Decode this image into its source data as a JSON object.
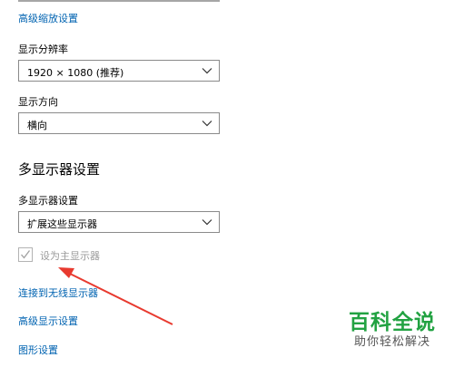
{
  "links": {
    "advanced_scaling": "高级缩放设置",
    "connect_wireless": "连接到无线显示器",
    "advanced_display": "高级显示设置",
    "graphics": "图形设置"
  },
  "resolution": {
    "label": "显示分辨率",
    "value": "1920 × 1080 (推荐)"
  },
  "orientation": {
    "label": "显示方向",
    "value": "横向"
  },
  "multi_display": {
    "section_title": "多显示器设置",
    "label": "多显示器设置",
    "value": "扩展这些显示器",
    "make_main_label": "设为主显示器",
    "make_main_checked": true,
    "make_main_disabled": true
  },
  "annotation": {
    "arrow_color": "#e83a2f"
  },
  "watermark": {
    "title": "百科全说",
    "subtitle": "助你轻松解决"
  },
  "colors": {
    "link": "#0063b1",
    "disabled_text": "#9a9a9a",
    "watermark_green": "#22a242"
  }
}
